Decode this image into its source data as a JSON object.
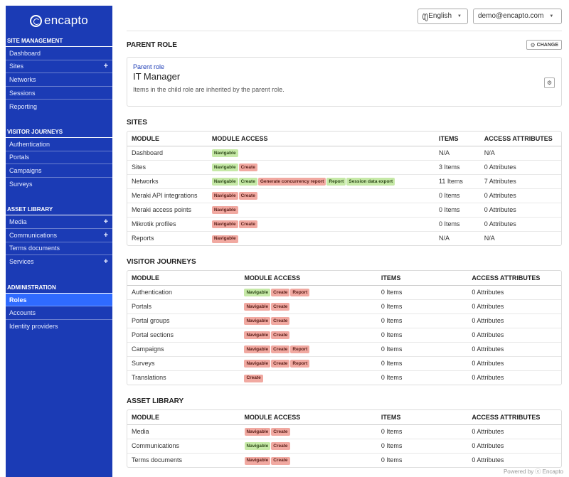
{
  "brand": {
    "name": "encapto"
  },
  "sidebar": {
    "sections": [
      {
        "heading": "Site Management",
        "items": [
          {
            "label": "Dashboard",
            "expand": false
          },
          {
            "label": "Sites",
            "expand": true
          },
          {
            "label": "Networks",
            "expand": false
          },
          {
            "label": "Sessions",
            "expand": false
          },
          {
            "label": "Reporting",
            "expand": false
          }
        ]
      },
      {
        "heading": "Visitor Journeys",
        "items": [
          {
            "label": "Authentication",
            "expand": false
          },
          {
            "label": "Portals",
            "expand": false
          },
          {
            "label": "Campaigns",
            "expand": false
          },
          {
            "label": "Surveys",
            "expand": false
          }
        ]
      },
      {
        "heading": "Asset Library",
        "items": [
          {
            "label": "Media",
            "expand": true
          },
          {
            "label": "Communications",
            "expand": true
          },
          {
            "label": "Terms documents",
            "expand": false
          },
          {
            "label": "Services",
            "expand": true
          }
        ]
      },
      {
        "heading": "Administration",
        "items": [
          {
            "label": "Roles",
            "expand": false,
            "active": true
          },
          {
            "label": "Accounts",
            "expand": false
          },
          {
            "label": "Identity providers",
            "expand": false
          }
        ]
      }
    ],
    "plus_symbol": "+"
  },
  "topbar": {
    "language": "English",
    "user": "demo@encapto.com",
    "caret": "▼"
  },
  "parent_role": {
    "title": "Parent Role",
    "change_label": "Change",
    "label": "Parent role",
    "name": "IT Manager",
    "description": "Items in the child role are inherited by the parent role."
  },
  "sites": {
    "title": "Sites",
    "columns": [
      "Module",
      "Module Access",
      "Items",
      "Access Attributes"
    ],
    "rows": [
      {
        "module": "Dashboard",
        "access": [
          {
            "label": "Navigable",
            "color": "green"
          }
        ],
        "items": "N/A",
        "attributes": "N/A"
      },
      {
        "module": "Sites",
        "access": [
          {
            "label": "Navigable",
            "color": "green"
          },
          {
            "label": "Create",
            "color": "red"
          }
        ],
        "items": "3 Items",
        "attributes": "0 Attributes"
      },
      {
        "module": "Networks",
        "access": [
          {
            "label": "Navigable",
            "color": "green"
          },
          {
            "label": "Create",
            "color": "green"
          },
          {
            "label": "Generate concurrency report",
            "color": "red"
          },
          {
            "label": "Report",
            "color": "green"
          },
          {
            "label": "Session data export",
            "color": "green"
          }
        ],
        "items": "11 Items",
        "attributes": "7 Attributes"
      },
      {
        "module": "Meraki API integrations",
        "access": [
          {
            "label": "Navigable",
            "color": "red"
          },
          {
            "label": "Create",
            "color": "red"
          }
        ],
        "items": "0 Items",
        "attributes": "0 Attributes"
      },
      {
        "module": "Meraki access points",
        "access": [
          {
            "label": "Navigable",
            "color": "red"
          }
        ],
        "items": "0 Items",
        "attributes": "0 Attributes"
      },
      {
        "module": "Mikrotik profiles",
        "access": [
          {
            "label": "Navigable",
            "color": "red"
          },
          {
            "label": "Create",
            "color": "red"
          }
        ],
        "items": "0 Items",
        "attributes": "0 Attributes"
      },
      {
        "module": "Reports",
        "access": [
          {
            "label": "Navigable",
            "color": "red"
          }
        ],
        "items": "N/A",
        "attributes": "N/A"
      }
    ]
  },
  "visitor_journeys": {
    "title": "Visitor Journeys",
    "columns": [
      "Module",
      "Module Access",
      "Items",
      "Access Attributes"
    ],
    "rows": [
      {
        "module": "Authentication",
        "access": [
          {
            "label": "Navigable",
            "color": "green"
          },
          {
            "label": "Create",
            "color": "red"
          },
          {
            "label": "Report",
            "color": "red"
          }
        ],
        "items": "0 Items",
        "attributes": "0 Attributes"
      },
      {
        "module": "Portals",
        "access": [
          {
            "label": "Navigable",
            "color": "red"
          },
          {
            "label": "Create",
            "color": "red"
          }
        ],
        "items": "0 Items",
        "attributes": "0 Attributes"
      },
      {
        "module": "Portal groups",
        "access": [
          {
            "label": "Navigable",
            "color": "red"
          },
          {
            "label": "Create",
            "color": "red"
          }
        ],
        "items": "0 Items",
        "attributes": "0 Attributes"
      },
      {
        "module": "Portal sections",
        "access": [
          {
            "label": "Navigable",
            "color": "red"
          },
          {
            "label": "Create",
            "color": "red"
          }
        ],
        "items": "0 Items",
        "attributes": "0 Attributes"
      },
      {
        "module": "Campaigns",
        "access": [
          {
            "label": "Navigable",
            "color": "red"
          },
          {
            "label": "Create",
            "color": "red"
          },
          {
            "label": "Report",
            "color": "red"
          }
        ],
        "items": "0 Items",
        "attributes": "0 Attributes"
      },
      {
        "module": "Surveys",
        "access": [
          {
            "label": "Navigable",
            "color": "red"
          },
          {
            "label": "Create",
            "color": "red"
          },
          {
            "label": "Report",
            "color": "red"
          }
        ],
        "items": "0 Items",
        "attributes": "0 Attributes"
      },
      {
        "module": "Translations",
        "access": [
          {
            "label": "Create",
            "color": "red"
          }
        ],
        "items": "0 Items",
        "attributes": "0 Attributes"
      }
    ]
  },
  "asset_library": {
    "title": "Asset Library",
    "columns": [
      "Module",
      "Module Access",
      "Items",
      "Access Attributes"
    ],
    "rows": [
      {
        "module": "Media",
        "access": [
          {
            "label": "Navigable",
            "color": "red"
          },
          {
            "label": "Create",
            "color": "red"
          }
        ],
        "items": "0 Items",
        "attributes": "0 Attributes"
      },
      {
        "module": "Communications",
        "access": [
          {
            "label": "Navigable",
            "color": "green"
          },
          {
            "label": "Create",
            "color": "red"
          }
        ],
        "items": "0 Items",
        "attributes": "0 Attributes"
      },
      {
        "module": "Terms documents",
        "access": [
          {
            "label": "Navigable",
            "color": "red"
          },
          {
            "label": "Create",
            "color": "red"
          }
        ],
        "items": "0 Items",
        "attributes": "0 Attributes"
      }
    ]
  },
  "colors": {
    "sidebar_bg": "#1b3bb5",
    "active_item": "#2f6bff",
    "badge_green": "#c6e9a7",
    "badge_red": "#f1a9a1"
  },
  "footer": {
    "text": "Powered by ⓔ Encapto"
  }
}
